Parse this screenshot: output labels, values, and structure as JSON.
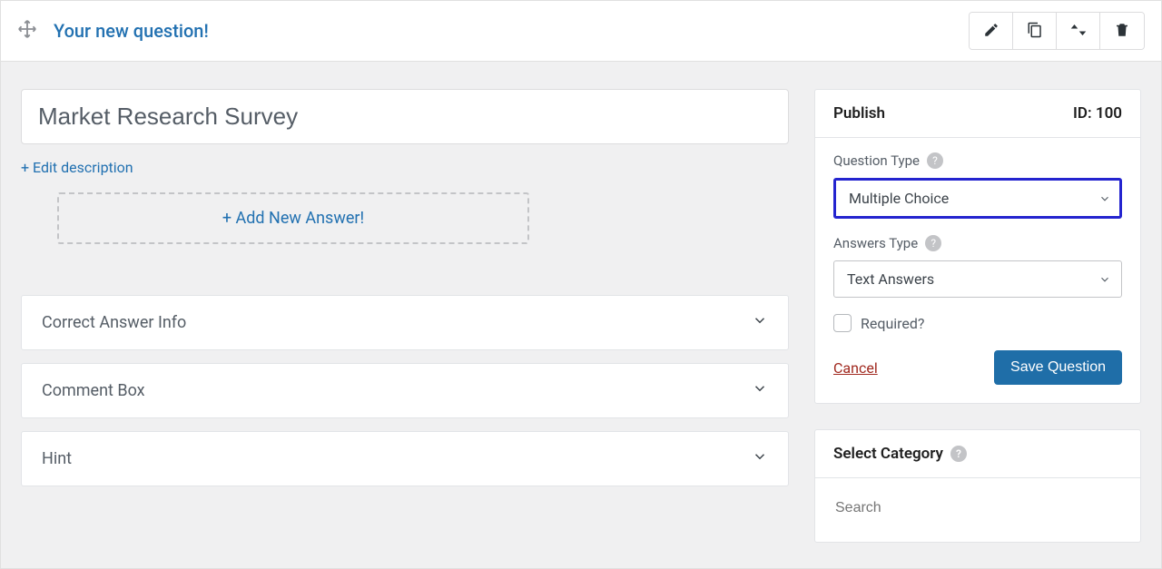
{
  "header": {
    "title": "Your new question!"
  },
  "toolbar": {
    "edit_icon": "edit-icon",
    "duplicate_icon": "duplicate-icon",
    "sort_icon": "sort-icon",
    "trash_icon": "trash-icon"
  },
  "main": {
    "title_value": "Market Research Survey",
    "edit_description_label": "+ Edit description",
    "add_answer_label": "+ Add New Answer!",
    "accordions": [
      {
        "label": "Correct Answer Info"
      },
      {
        "label": "Comment Box"
      },
      {
        "label": "Hint"
      }
    ]
  },
  "publish": {
    "panel_title": "Publish",
    "id_label": "ID: 100",
    "question_type_label": "Question Type",
    "question_type_value": "Multiple Choice",
    "answers_type_label": "Answers Type",
    "answers_type_value": "Text Answers",
    "required_label": "Required?",
    "cancel_label": "Cancel",
    "save_label": "Save Question"
  },
  "category": {
    "panel_title": "Select Category",
    "search_placeholder": "Search"
  }
}
